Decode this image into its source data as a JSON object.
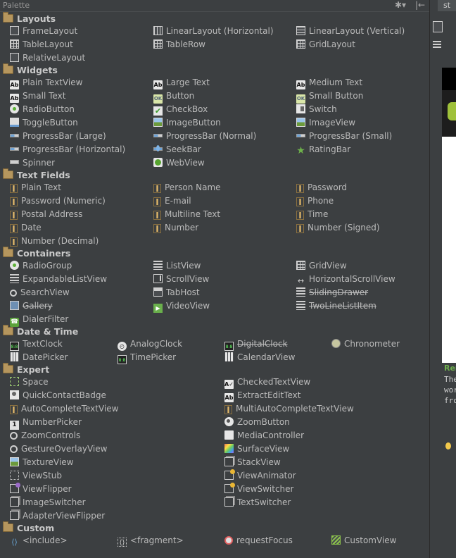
{
  "palette": {
    "title": "Palette",
    "settings_glyph": "✱▾",
    "pin_glyph": "|←"
  },
  "categories": {
    "layouts": "Layouts",
    "widgets": "Widgets",
    "text_fields": "Text Fields",
    "containers": "Containers",
    "date_time": "Date & Time",
    "expert": "Expert",
    "custom": "Custom"
  },
  "layouts": {
    "frame": "FrameLayout",
    "linear_h": "LinearLayout (Horizontal)",
    "linear_v": "LinearLayout (Vertical)",
    "table": "TableLayout",
    "table_row": "TableRow",
    "grid": "GridLayout",
    "relative": "RelativeLayout"
  },
  "widgets": {
    "plain_textview": "Plain TextView",
    "large_text": "Large Text",
    "medium_text": "Medium Text",
    "small_text": "Small Text",
    "button": "Button",
    "small_button": "Small Button",
    "radio_button": "RadioButton",
    "checkbox": "CheckBox",
    "switch": "Switch",
    "toggle_button": "ToggleButton",
    "image_button": "ImageButton",
    "image_view": "ImageView",
    "progress_large": "ProgressBar (Large)",
    "progress_normal": "ProgressBar (Normal)",
    "progress_small": "ProgressBar (Small)",
    "progress_horizontal": "ProgressBar (Horizontal)",
    "seekbar": "SeekBar",
    "ratingbar": "RatingBar",
    "spinner": "Spinner",
    "webview": "WebView"
  },
  "text_fields": {
    "plain_text": "Plain Text",
    "person_name": "Person Name",
    "password": "Password",
    "password_numeric": "Password (Numeric)",
    "email": "E-mail",
    "phone": "Phone",
    "postal_address": "Postal Address",
    "multiline_text": "Multiline Text",
    "time": "Time",
    "date": "Date",
    "number": "Number",
    "number_signed": "Number (Signed)",
    "number_decimal": "Number (Decimal)"
  },
  "containers": {
    "radio_group": "RadioGroup",
    "list_view": "ListView",
    "grid_view": "GridView",
    "expandable_list_view": "ExpandableListView",
    "scroll_view": "ScrollView",
    "horizontal_scroll_view": "HorizontalScrollView",
    "search_view": "SearchView",
    "tab_host": "TabHost",
    "sliding_drawer": "SlidingDrawer",
    "gallery": "Gallery",
    "video_view": "VideoView",
    "two_line_list_item": "TwoLineListItem",
    "dialer_filter": "DialerFilter"
  },
  "date_time": {
    "text_clock": "TextClock",
    "analog_clock": "AnalogClock",
    "digital_clock": "DigitalClock",
    "chronometer": "Chronometer",
    "date_picker": "DatePicker",
    "time_picker": "TimePicker",
    "calendar_view": "CalendarView"
  },
  "expert": {
    "space": "Space",
    "checked_text_view": "CheckedTextView",
    "quick_contact_badge": "QuickContactBadge",
    "extract_edit_text": "ExtractEditText",
    "auto_complete_text_view": "AutoCompleteTextView",
    "multi_auto_complete_text_view": "MultiAutoCompleteTextView",
    "number_picker": "NumberPicker",
    "zoom_button": "ZoomButton",
    "zoom_controls": "ZoomControls",
    "media_controller": "MediaController",
    "gesture_overlay_view": "GestureOverlayView",
    "surface_view": "SurfaceView",
    "texture_view": "TextureView",
    "stack_view": "StackView",
    "view_stub": "ViewStub",
    "view_animator": "ViewAnimator",
    "view_flipper": "ViewFlipper",
    "view_switcher": "ViewSwitcher",
    "image_switcher": "ImageSwitcher",
    "text_switcher": "TextSwitcher",
    "adapter_view_flipper": "AdapterViewFlipper"
  },
  "custom": {
    "include": "<include>",
    "fragment": "<fragment>",
    "request_focus": "requestFocus",
    "custom_view": "CustomView"
  },
  "side_panel": {
    "tab_label": "st",
    "render_title": "Ren",
    "render_lines": [
      "The",
      "wor",
      "fro"
    ]
  }
}
